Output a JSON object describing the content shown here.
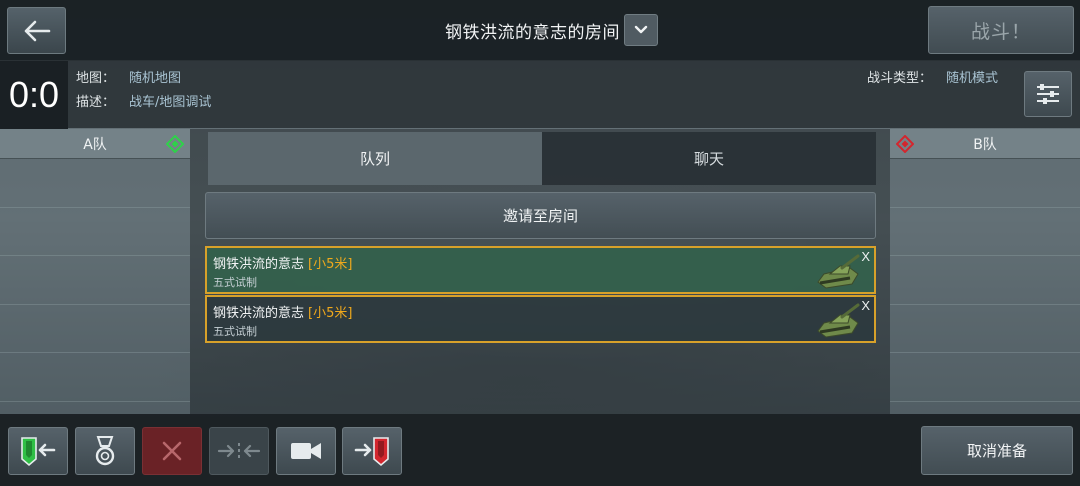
{
  "header": {
    "room_title": "钢铁洪流的意志的房间",
    "battle_label": "战斗！"
  },
  "info": {
    "score": "0:0",
    "map_key": "地图：",
    "map_value": "随机地图",
    "desc_key": "描述：",
    "desc_value": "战车/地图调试",
    "mode_key": "战斗类型：",
    "mode_value": "随机模式"
  },
  "teams": {
    "a_label": "A队",
    "a_color": "#2fd14a",
    "b_label": "B队",
    "b_color": "#d3262e"
  },
  "tabs": [
    {
      "label": "队列",
      "active": true
    },
    {
      "label": "聊天",
      "active": false
    }
  ],
  "invite_label": "邀请至房间",
  "players": [
    {
      "name": "钢铁洪流的意志",
      "tag": "[小5米]",
      "vehicle": "五式试制",
      "remove": "X"
    },
    {
      "name": "钢铁洪流的意志",
      "tag": "[小5米]",
      "vehicle": "五式试制",
      "remove": "X"
    }
  ],
  "footer": {
    "cancel_ready_label": "取消准备"
  },
  "icons": {
    "back": "back-arrow-icon",
    "dropdown": "chevron-down-icon",
    "settings": "sliders-icon",
    "join_a": "join-team-a-icon",
    "medal": "medal-icon",
    "kick": "close-icon",
    "swap": "swap-icon",
    "spectate": "camera-icon",
    "join_b": "join-team-b-icon",
    "tank": "tank-icon"
  },
  "colors": {
    "accent_gold": "#f0a91c",
    "selected_row": "#34604c"
  }
}
